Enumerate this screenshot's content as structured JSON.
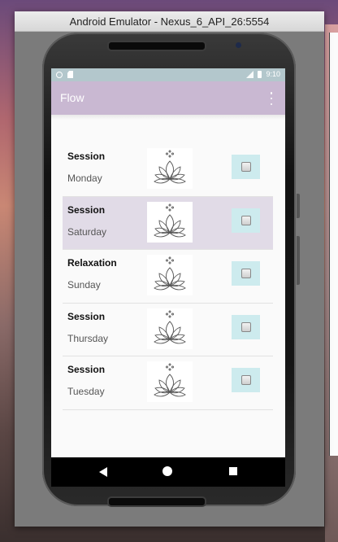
{
  "window": {
    "title": "Android Emulator - Nexus_6_API_26:5554"
  },
  "statusbar": {
    "time": "9:10",
    "left_icons": [
      "circle-icon",
      "sd-card-icon"
    ],
    "right_icons": [
      "signal-icon",
      "battery-icon"
    ]
  },
  "appbar": {
    "title": "Flow",
    "menu_icon": "overflow-menu-icon",
    "color": "#c9b8d2"
  },
  "list": {
    "items": [
      {
        "name": "Session",
        "day": "Monday",
        "selected": false,
        "icon": "lotus-icon",
        "checked": false
      },
      {
        "name": "Session",
        "day": "Saturday",
        "selected": true,
        "icon": "lotus-icon",
        "checked": false
      },
      {
        "name": "Relaxation",
        "day": "Sunday",
        "selected": false,
        "icon": "lotus-icon",
        "checked": false
      },
      {
        "name": "Session",
        "day": "Thursday",
        "selected": false,
        "icon": "lotus-icon",
        "checked": false
      },
      {
        "name": "Session",
        "day": "Tuesday",
        "selected": false,
        "icon": "lotus-icon",
        "checked": false
      }
    ]
  },
  "navbar": {
    "icons": [
      "back-icon",
      "home-icon",
      "recent-apps-icon"
    ]
  },
  "colors": {
    "selected_row": "#e1dbe7",
    "checkbox_bg": "#cdebee",
    "statusbar": "#b3c7cc"
  }
}
